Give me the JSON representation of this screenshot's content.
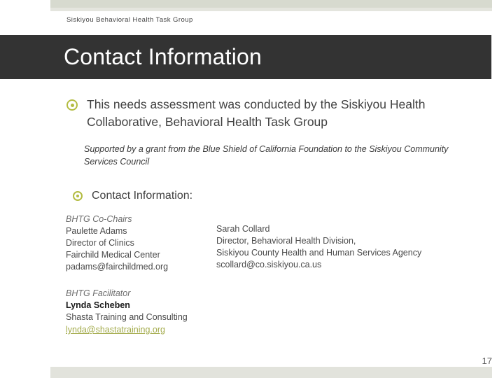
{
  "slide": {
    "kicker": "Siskiyou Behavioral Health Task Group",
    "title": "Contact Information",
    "page_number": "17",
    "colors": {
      "title_bar": "#333333",
      "band": "#d7dacf",
      "band_light": "#e4e5de",
      "bullet_accent": "#b3bc42",
      "link": "#a3ab4b",
      "body_text": "#414141"
    }
  },
  "bullets": [
    {
      "id": "needs-assessment",
      "text": "This needs assessment was conducted by the Siskiyou Health Collaborative, Behavioral Health Task Group"
    },
    {
      "id": "contact-information",
      "text": "Contact Information:"
    }
  ],
  "note": "Supported by a grant from the Blue Shield of California Foundation to the Siskiyou Community Services Council",
  "contacts": {
    "co_chairs_heading": "BHTG Co-Chairs",
    "left": {
      "name": "Paulette Adams",
      "title": "Director of Clinics",
      "organization": "Fairchild Medical Center",
      "email": "padams@fairchildmed.org"
    },
    "right": {
      "name": "Sarah Collard",
      "title": "Director, Behavioral Health Division,",
      "organization": "Siskiyou County Health and Human Services Agency",
      "email": "scollard@co.siskiyou.ca.us"
    },
    "facilitator": {
      "heading": "BHTG Facilitator",
      "name": "Lynda Scheben",
      "organization": "Shasta Training and Consulting",
      "email": "lynda@shastatraining.org"
    }
  }
}
